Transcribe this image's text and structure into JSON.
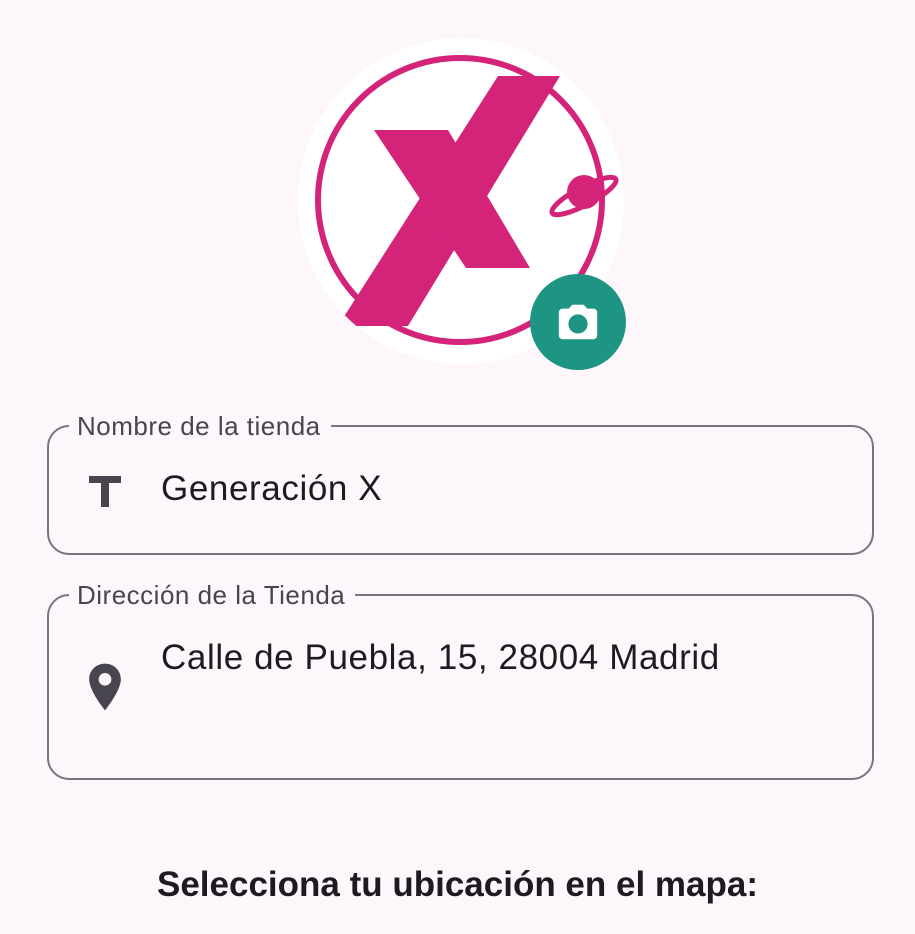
{
  "avatar": {
    "logo_letter": "X",
    "brand_color": "#D4247A",
    "camera_button_color": "#1E9483",
    "camera_icon": "camera-icon"
  },
  "form": {
    "store_name": {
      "label": "Nombre de la tienda",
      "value": "Generación X",
      "icon": "text-fields-icon"
    },
    "store_address": {
      "label": "Dirección de la Tienda",
      "value": "Calle de Puebla, 15, 28004 Madrid",
      "icon": "location-pin-icon"
    }
  },
  "map_section": {
    "heading": "Selecciona tu ubicación en el mapa:"
  },
  "colors": {
    "background": "#FDF7FC",
    "outline": "#79747E",
    "label_text": "#49454F",
    "body_text": "#1D1B20"
  }
}
